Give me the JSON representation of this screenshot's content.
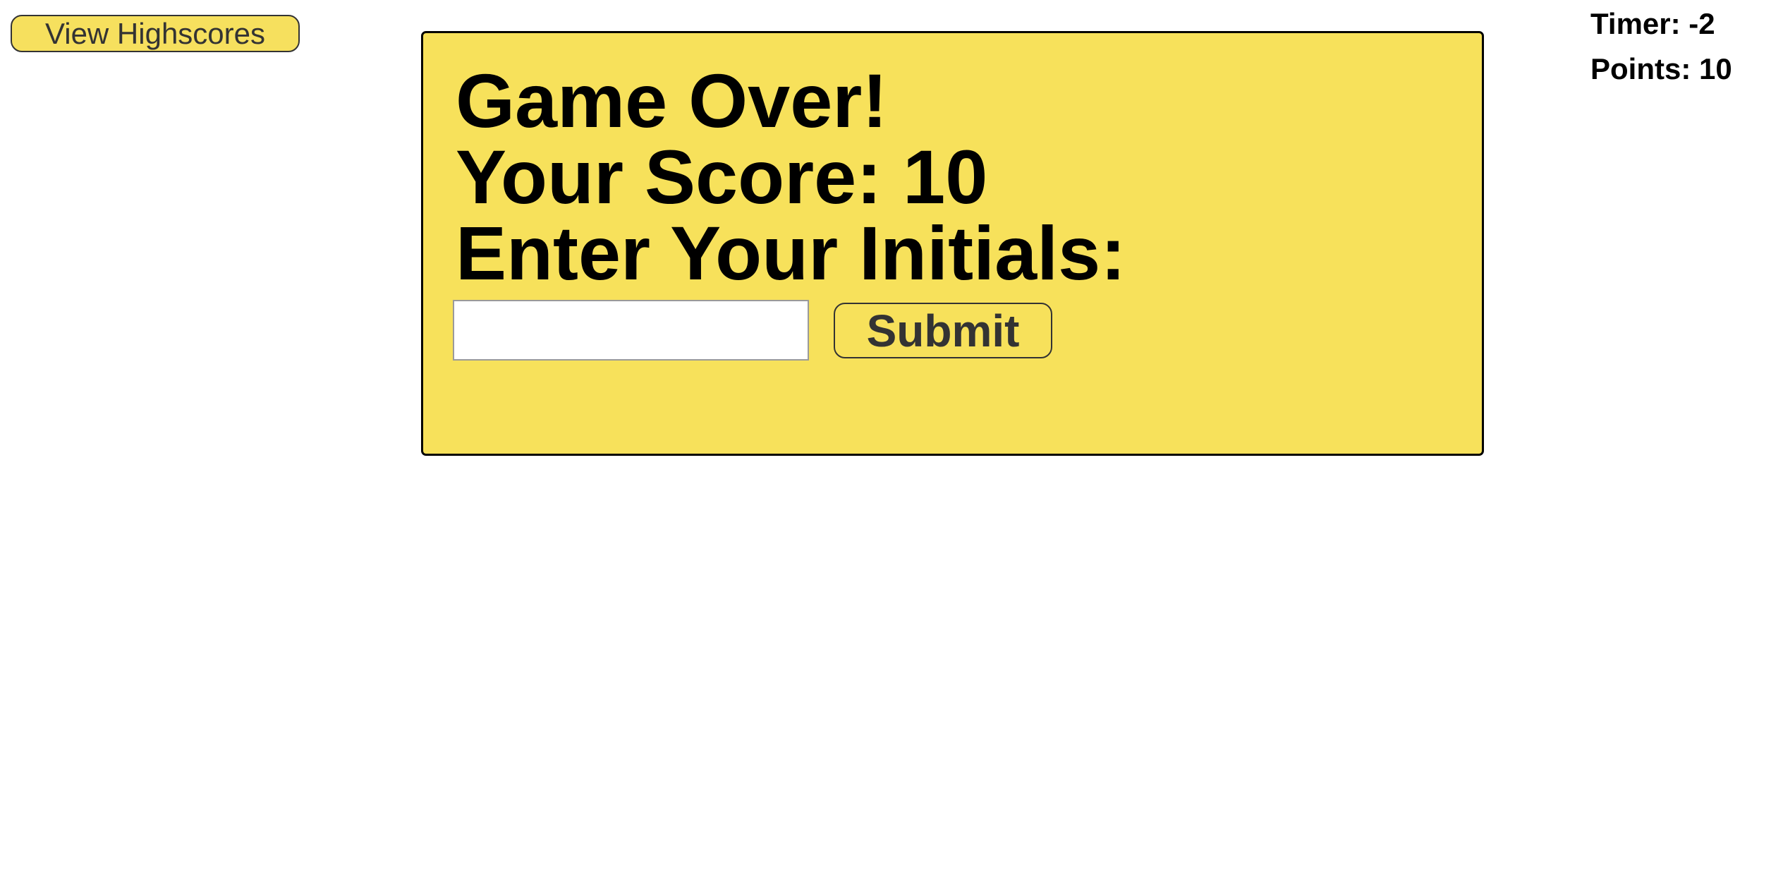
{
  "header": {
    "highscores_label": "View Highscores",
    "timer_text": "Timer: -2",
    "points_text": "Points: 10"
  },
  "game_over_card": {
    "title": "Game Over!",
    "score_text": "Your Score: 10",
    "prompt": "Enter Your Initials:",
    "initials_input": {
      "value": "",
      "placeholder": ""
    },
    "submit_label": "Submit"
  },
  "colors": {
    "accent_yellow": "#f7e15b",
    "text": "#000000",
    "button_text": "#333333"
  }
}
